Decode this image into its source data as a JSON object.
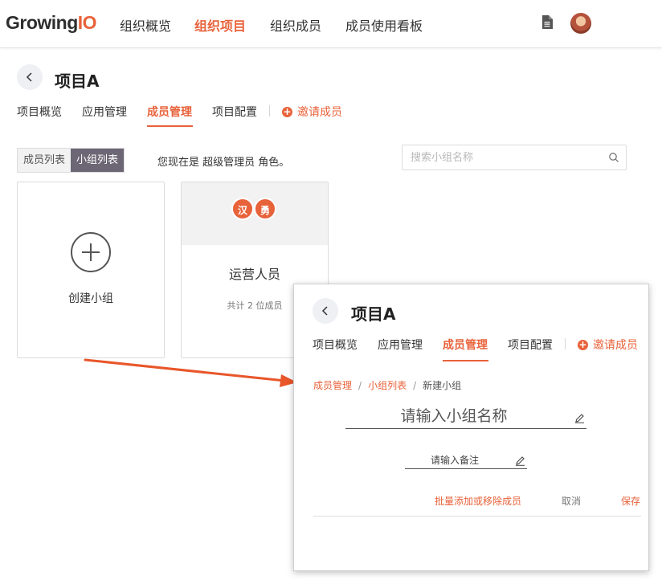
{
  "topnav": {
    "logo_text": "Growing",
    "logo_accent": "IO",
    "items": [
      {
        "label": "组织概览",
        "active": false
      },
      {
        "label": "组织项目",
        "active": true
      },
      {
        "label": "组织成员",
        "active": false
      },
      {
        "label": "成员使用看板",
        "active": false
      }
    ],
    "doc_icon": "document-icon",
    "avatar_icon": "user-avatar"
  },
  "page": {
    "title": "项目A",
    "tabs": [
      {
        "label": "项目概览",
        "active": false
      },
      {
        "label": "应用管理",
        "active": false
      },
      {
        "label": "成员管理",
        "active": true
      },
      {
        "label": "项目配置",
        "active": false
      }
    ],
    "invite_label": "邀请成员",
    "segments": [
      {
        "label": "成员列表",
        "active": false
      },
      {
        "label": "小组列表",
        "active": true
      }
    ],
    "role_text": "您现在是 超级管理员 角色。",
    "search_placeholder": "搜索小组名称"
  },
  "cards": {
    "create_label": "创建小组",
    "group": {
      "avatars": [
        "汉",
        "勇"
      ],
      "name": "运营人员",
      "count_text": "共计 2 位成员"
    }
  },
  "overlay": {
    "title": "项目A",
    "tabs": [
      {
        "label": "项目概览",
        "active": false
      },
      {
        "label": "应用管理",
        "active": false
      },
      {
        "label": "成员管理",
        "active": true
      },
      {
        "label": "项目配置",
        "active": false
      }
    ],
    "invite_label": "邀请成员",
    "breadcrumb": [
      {
        "label": "成员管理",
        "link": true
      },
      {
        "label": "小组列表",
        "link": true
      },
      {
        "label": "新建小组",
        "link": false
      }
    ],
    "name_placeholder": "请输入小组名称",
    "note_placeholder": "请输入备注",
    "batch_label": "批量添加或移除成员",
    "cancel_label": "取消",
    "save_label": "保存"
  },
  "colors": {
    "accent": "#e8623a",
    "segment_active": "#6c6675"
  }
}
